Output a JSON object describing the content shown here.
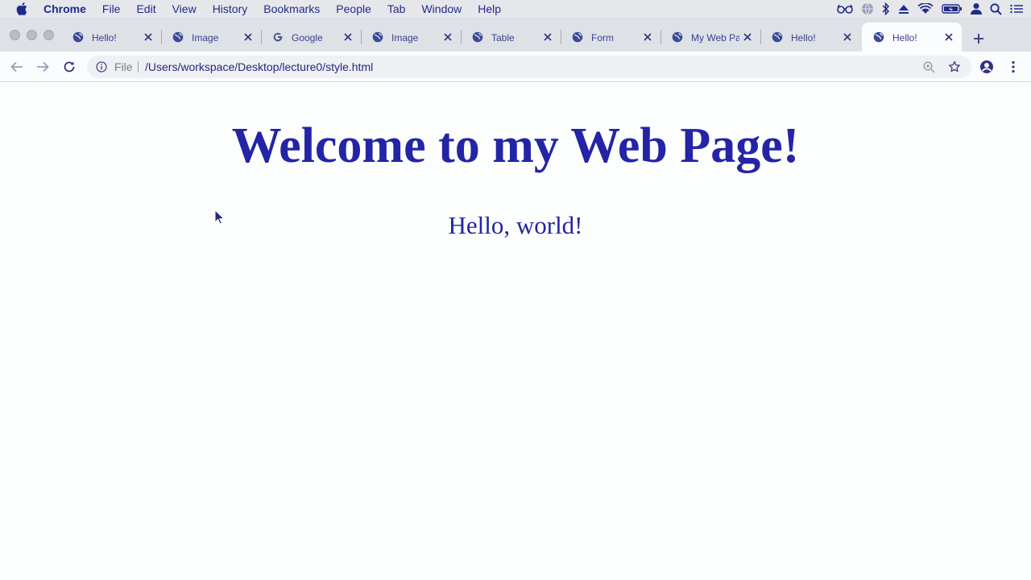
{
  "menubar": {
    "app_name": "Chrome",
    "items": [
      "File",
      "Edit",
      "View",
      "History",
      "Bookmarks",
      "People",
      "Tab",
      "Window",
      "Help"
    ],
    "status_icons": [
      "glasses-icon",
      "globe-icon",
      "bluetooth-icon",
      "eject-icon",
      "wifi-icon",
      "battery-icon",
      "user-icon",
      "search-icon",
      "menu-list-icon"
    ]
  },
  "tabs": [
    {
      "title": "Hello!",
      "favicon": "globe-icon",
      "active": false
    },
    {
      "title": "Image",
      "favicon": "globe-icon",
      "active": false
    },
    {
      "title": "Google",
      "favicon": "google-icon",
      "active": false
    },
    {
      "title": "Image",
      "favicon": "globe-icon",
      "active": false
    },
    {
      "title": "Table",
      "favicon": "globe-icon",
      "active": false
    },
    {
      "title": "Form",
      "favicon": "globe-icon",
      "active": false
    },
    {
      "title": "My Web Pa",
      "favicon": "globe-icon",
      "active": false
    },
    {
      "title": "Hello!",
      "favicon": "globe-icon",
      "active": false
    },
    {
      "title": "Hello!",
      "favicon": "globe-icon",
      "active": true
    }
  ],
  "toolbar": {
    "scheme": "File",
    "url": "/Users/workspace/Desktop/lecture0/style.html"
  },
  "page": {
    "heading": "Welcome to my Web Page!",
    "paragraph": "Hello, world!"
  },
  "colors": {
    "heading": "#2424a6",
    "menubar": "#e6e7ea",
    "tabstrip": "#dee1e6",
    "page_background": "#fbfefc"
  }
}
